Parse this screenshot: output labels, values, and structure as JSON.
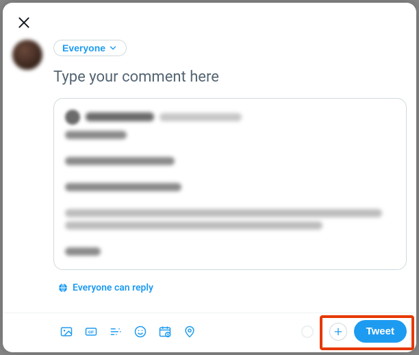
{
  "audience": {
    "label": "Everyone"
  },
  "composer": {
    "placeholder": "Type your comment here"
  },
  "reply_settings": {
    "label": "Everyone can reply"
  },
  "toolbar": {
    "media": "Media",
    "gif": "GIF",
    "poll": "Poll",
    "emoji": "Emoji",
    "schedule": "Schedule",
    "location": "Location",
    "add_thread": "Add",
    "tweet": "Tweet"
  },
  "icons": {
    "close": "close-icon",
    "chevron_down": "chevron-down-icon",
    "globe": "globe-icon",
    "image": "image-icon",
    "gif": "gif-icon",
    "poll": "poll-icon",
    "emoji": "emoji-icon",
    "schedule": "schedule-icon",
    "location": "location-icon",
    "plus": "plus-icon"
  },
  "colors": {
    "primary": "#1d9bf0",
    "highlight": "#e63900",
    "text_muted": "#536471"
  }
}
